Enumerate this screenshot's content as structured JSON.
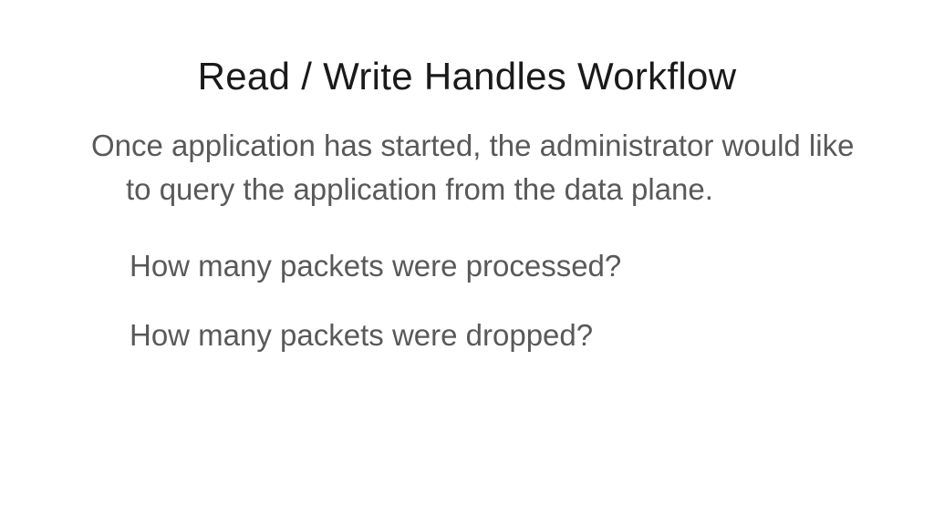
{
  "slide": {
    "title": "Read / Write Handles Workflow",
    "description": "Once application has started, the administrator would like to query the application from the data plane.",
    "questions": [
      "How many packets were processed?",
      "How many packets were dropped?"
    ]
  }
}
